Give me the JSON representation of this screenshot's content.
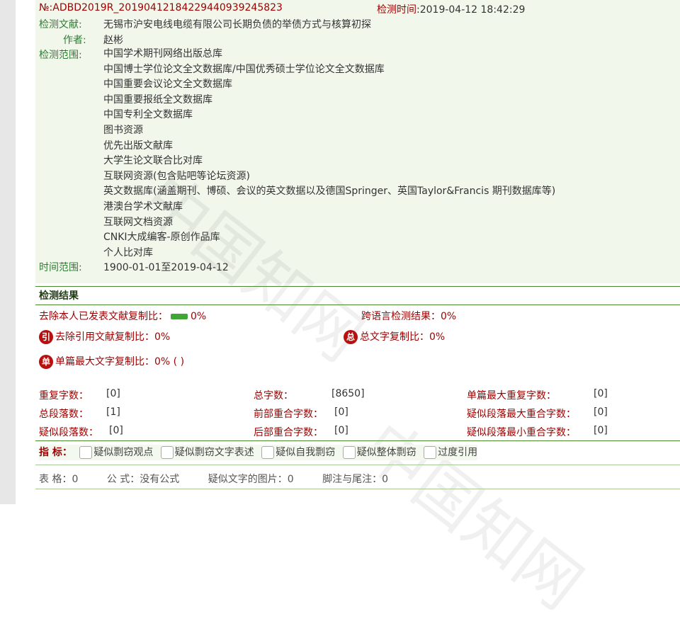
{
  "header": {
    "report_no": "№:ADBD2019R_20190412184229440939245823",
    "check_time_label": "检测时间",
    "check_time_value": ":2019-04-12 18:42:29"
  },
  "meta": {
    "doc_label": "检测文献:",
    "doc_value": "无锡市沪安电线电缆有限公司长期负债的举债方式与核算初探",
    "author_label": "作者:",
    "author_value": "赵彬",
    "scope_label": "检测范围:",
    "scope_items": [
      "中国学术期刊网络出版总库",
      "中国博士学位论文全文数据库/中国优秀硕士学位论文全文数据库",
      "中国重要会议论文全文数据库",
      "中国重要报纸全文数据库",
      "中国专利全文数据库",
      "图书资源",
      "优先出版文献库",
      "大学生论文联合比对库",
      "互联网资源(包含贴吧等论坛资源)",
      "英文数据库(涵盖期刊、博硕、会议的英文数据以及德国Springer、英国Taylor&Francis 期刊数据库等)",
      "港澳台学术文献库",
      "互联网文档资源",
      "CNKI大成编客-原创作品库",
      "个人比对库"
    ],
    "time_label": "时间范围:",
    "time_value": "1900-01-01至2019-04-12"
  },
  "results": {
    "title": "检测结果",
    "self_excluded_label": "去除本人已发表文献复制比：",
    "self_excluded_value": "0%",
    "cross_lang_label": "跨语言检测结果：",
    "cross_lang_value": "0%",
    "cite_badge": "引",
    "cite_excluded_label": "去除引用文献复制比：",
    "cite_excluded_value": "0%",
    "total_badge": "总",
    "total_label": "总文字复制比：",
    "total_value": "0%",
    "single_badge": "单",
    "single_label": "单篇最大文字复制比：",
    "single_value": "0% ( )"
  },
  "stats": {
    "dup_chars_label": "重复字数：",
    "dup_chars_value": "[0]",
    "total_chars_label": "总字数：",
    "total_chars_value": "[8650]",
    "single_max_dup_label": "单篇最大重复字数：",
    "single_max_dup_value": "[0]",
    "total_paras_label": "总段落数：",
    "total_paras_value": "[1]",
    "front_overlap_label": "前部重合字数：",
    "front_overlap_value": "[0]",
    "para_max_overlap_label": "疑似段落最大重合字数：",
    "para_max_overlap_value": "[0]",
    "susp_paras_label": "疑似段落数：",
    "susp_paras_value": "[0]",
    "back_overlap_label": "后部重合字数：",
    "back_overlap_value": "[0]",
    "para_min_overlap_label": "疑似段落最小重合字数：",
    "para_min_overlap_value": "[0]"
  },
  "indicators": {
    "label": "指  标：",
    "options": [
      "疑似剽窃观点",
      "疑似剽窃文字表述",
      "疑似自我剽窃",
      "疑似整体剽窃",
      "过度引用"
    ]
  },
  "footer": {
    "tables": "表  格：0",
    "formulas": "公  式：没有公式",
    "images": "疑似文字的图片：0",
    "footnotes": "脚注与尾注：0"
  },
  "watermark_text": [
    "中国知网",
    "中国知网"
  ]
}
